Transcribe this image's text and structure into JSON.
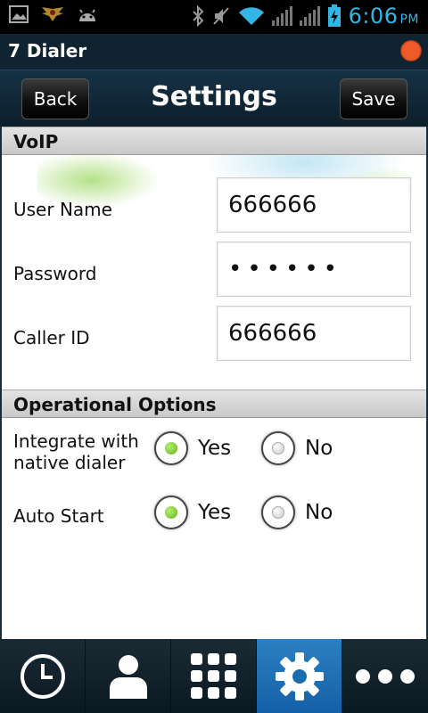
{
  "statusbar": {
    "time": "6:06",
    "ampm": "PM"
  },
  "app": {
    "title": "7 Dialer"
  },
  "header": {
    "title": "Settings",
    "back_label": "Back",
    "save_label": "Save"
  },
  "voip": {
    "section_title": "VoIP",
    "username_label": "User Name",
    "username_value": "666666",
    "password_label": "Password",
    "password_value": "••••••",
    "callerid_label": "Caller ID",
    "callerid_value": "666666"
  },
  "options": {
    "section_title": "Operational Options",
    "integrate_label": "Integrate with native dialer",
    "integrate_line1": "Integrate with",
    "integrate_line2": "native dialer",
    "autostart_label": "Auto Start",
    "yes_label": "Yes",
    "no_label": "No",
    "integrate_selected": "Yes",
    "autostart_selected": "Yes"
  },
  "nav": {
    "items": [
      {
        "icon": "history-clock-icon",
        "active": false
      },
      {
        "icon": "contacts-person-icon",
        "active": false
      },
      {
        "icon": "dialpad-icon",
        "active": false
      },
      {
        "icon": "settings-gear-icon",
        "active": true
      },
      {
        "icon": "more-dots-icon",
        "active": false
      }
    ]
  },
  "colors": {
    "accent": "#2c7fc2",
    "radio_on": "#6cc22a",
    "orange": "#ef5a2a"
  }
}
